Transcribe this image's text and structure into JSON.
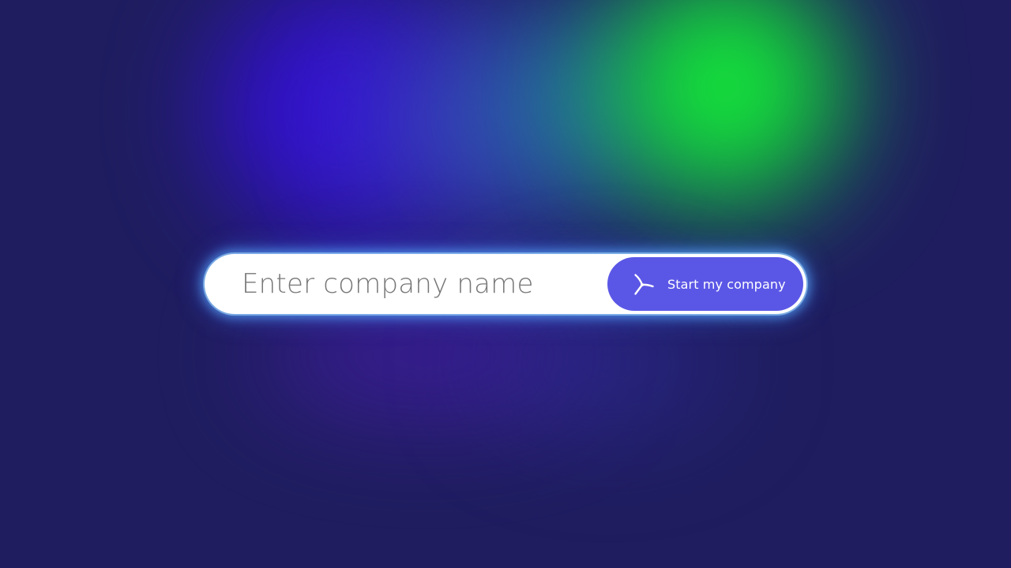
{
  "background": {
    "base_color": "#1f1d5f",
    "glow_colors": [
      "#3510d8",
      "#3a3dbf",
      "#21789a",
      "#14e33a",
      "#4b1db6"
    ]
  },
  "company_form": {
    "input_placeholder": "Enter company name",
    "input_value": "",
    "button_label": "Start my company",
    "button_icon": "tri-spoke-logo-icon",
    "button_color": "#5b57e6",
    "input_background": "#ffffff",
    "glow_color": "#5aaaff"
  }
}
